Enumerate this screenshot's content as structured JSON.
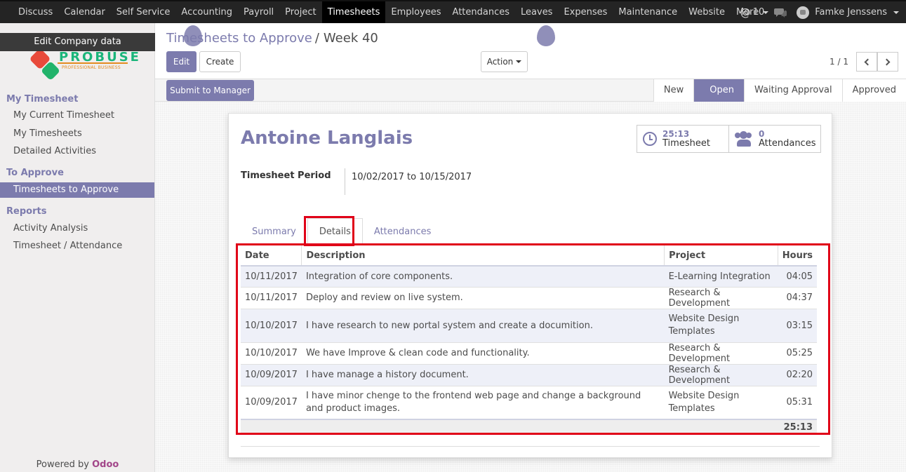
{
  "topbar": {
    "menu": [
      "Discuss",
      "Calendar",
      "Self Service",
      "Accounting",
      "Payroll",
      "Project",
      "Timesheets",
      "Employees",
      "Attendances",
      "Leaves",
      "Expenses",
      "Maintenance",
      "Website",
      "More"
    ],
    "active": "Timesheets",
    "mentions_count": "10",
    "user_name": "Famke Jenssens"
  },
  "sidebar": {
    "tooltip": "Edit Company data",
    "logo_title": "PROBUSE",
    "logo_tagline": "PROFESSIONAL BUSINESS",
    "sections": [
      {
        "title": "My Timesheet",
        "items": [
          "My Current Timesheet",
          "My Timesheets",
          "Detailed Activities"
        ]
      },
      {
        "title": "To Approve",
        "items": [
          "Timesheets to Approve"
        ]
      },
      {
        "title": "Reports",
        "items": [
          "Activity Analysis",
          "Timesheet / Attendance"
        ]
      }
    ],
    "active_item": "Timesheets to Approve",
    "powered_by": "Powered by",
    "powered_brand": "Odoo"
  },
  "control": {
    "breadcrumb_parent": "Timesheets to Approve",
    "breadcrumb_current": "Week 40",
    "edit_label": "Edit",
    "create_label": "Create",
    "action_label": "Action",
    "pager": "1 / 1"
  },
  "statusbar": {
    "submit_label": "Submit to Manager",
    "steps": [
      "New",
      "Open",
      "Waiting Approval",
      "Approved"
    ],
    "active_step": "Open"
  },
  "form": {
    "employee": "Antoine Langlais",
    "smart_buttons": [
      {
        "value": "25:13",
        "label": "Timesheet",
        "icon": "clock-icon"
      },
      {
        "value": "0",
        "label": "Attendances",
        "icon": "users-icon"
      }
    ],
    "period_label": "Timesheet Period",
    "period_value": "10/02/2017 to 10/15/2017",
    "tabs": [
      "Summary",
      "Details",
      "Attendances"
    ],
    "active_tab": "Details",
    "table": {
      "headers": [
        "Date",
        "Description",
        "Project",
        "Hours"
      ],
      "rows": [
        {
          "date": "10/11/2017",
          "description": "Integration of core components.",
          "project": "E-Learning Integration",
          "hours": "04:05"
        },
        {
          "date": "10/11/2017",
          "description": "Deploy and review on live system.",
          "project": "Research & Development",
          "hours": "04:37"
        },
        {
          "date": "10/10/2017",
          "description": "I have research to new portal system and create a documition.",
          "project": "Website Design Templates",
          "hours": "03:15"
        },
        {
          "date": "10/10/2017",
          "description": "We have Improve & clean code and functionality.",
          "project": "Research & Development",
          "hours": "05:25"
        },
        {
          "date": "10/09/2017",
          "description": "I have manage a history document.",
          "project": "Research & Development",
          "hours": "02:20"
        },
        {
          "date": "10/09/2017",
          "description": "I have minor chenge to the frontend web page and change a background and product images.",
          "project": "Website Design Templates",
          "hours": "05:31"
        }
      ],
      "total": "25:13"
    }
  },
  "colors": {
    "accent": "#7c7bad",
    "highlight": "#e00018",
    "topbar": "#242424"
  }
}
